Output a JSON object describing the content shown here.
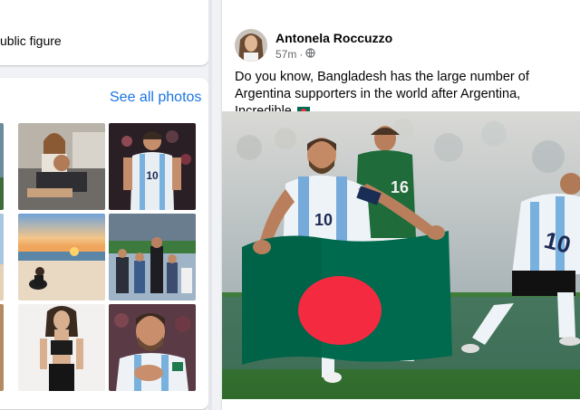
{
  "intro": {
    "category_text": "ublic figure"
  },
  "photos": {
    "see_all_label": "See all photos",
    "items": [
      {
        "name": "photo-family-couch"
      },
      {
        "name": "photo-messi-jersey-10"
      },
      {
        "name": "photo-beach-sunset"
      },
      {
        "name": "photo-family-stadium"
      },
      {
        "name": "photo-woman-mirror"
      },
      {
        "name": "photo-messi-hand-on-chest"
      }
    ]
  },
  "post": {
    "author": "Antonela Roccuzzo",
    "time": "57m",
    "separator": "·",
    "text": "Do you know, Bangladesh has the large number of Argentina supporters in the world after Argentina, Incredible",
    "image_jersey_number": "10",
    "image_opponent_number": "16"
  },
  "colors": {
    "link_blue": "#1b74e4",
    "bangladesh_green": "#006a4e",
    "bangladesh_red": "#f42a41",
    "argentina_blue": "#75aadb",
    "mexico_green": "#1f6b3a"
  }
}
